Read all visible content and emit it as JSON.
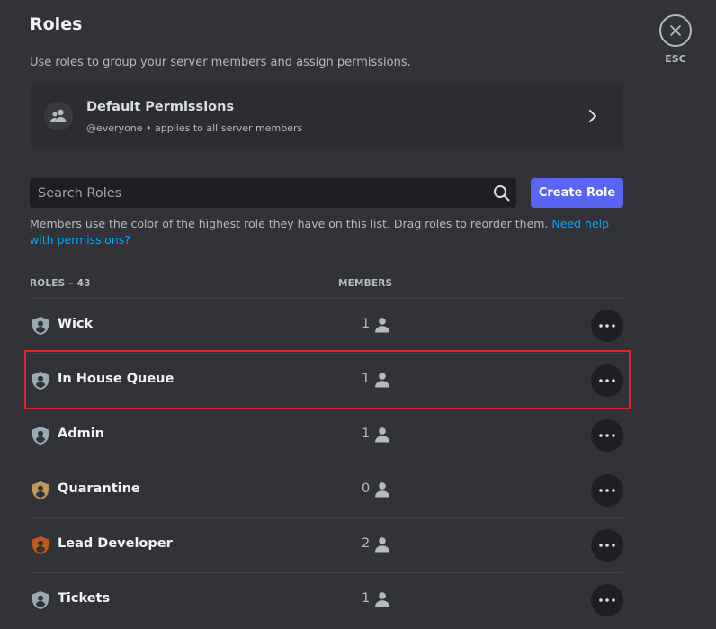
{
  "header": {
    "title": "Roles",
    "subtitle": "Use roles to group your server members and assign permissions."
  },
  "default_permissions": {
    "title": "Default Permissions",
    "description": "@everyone • applies to all server members",
    "icon": "people-icon"
  },
  "search": {
    "placeholder": "Search Roles",
    "value": ""
  },
  "create_role": {
    "label": "Create Role"
  },
  "help": {
    "text": "Members use the color of the highest role they have on this list. Drag roles to reorder them.",
    "link": "Need help with permissions?"
  },
  "table": {
    "roles_header": "ROLES – 43",
    "members_header": "MEMBERS"
  },
  "roles": [
    {
      "name": "Wick",
      "members": "1",
      "color": "#99aab5"
    },
    {
      "name": "In House Queue",
      "members": "1",
      "color": "#99aab5",
      "highlighted": true
    },
    {
      "name": "Admin",
      "members": "1",
      "color": "#99aab5"
    },
    {
      "name": "Quarantine",
      "members": "0",
      "color": "#c29a58"
    },
    {
      "name": "Lead Developer",
      "members": "2",
      "color": "#c15b1c"
    },
    {
      "name": "Tickets",
      "members": "1",
      "color": "#99aab5"
    }
  ],
  "close": {
    "label": "ESC"
  },
  "colors": {
    "background": "#313338",
    "card": "#2b2d31",
    "input": "#1e1f22",
    "accent": "#5865f2",
    "link": "#00a8fc",
    "highlight_box": "#e0262d"
  }
}
